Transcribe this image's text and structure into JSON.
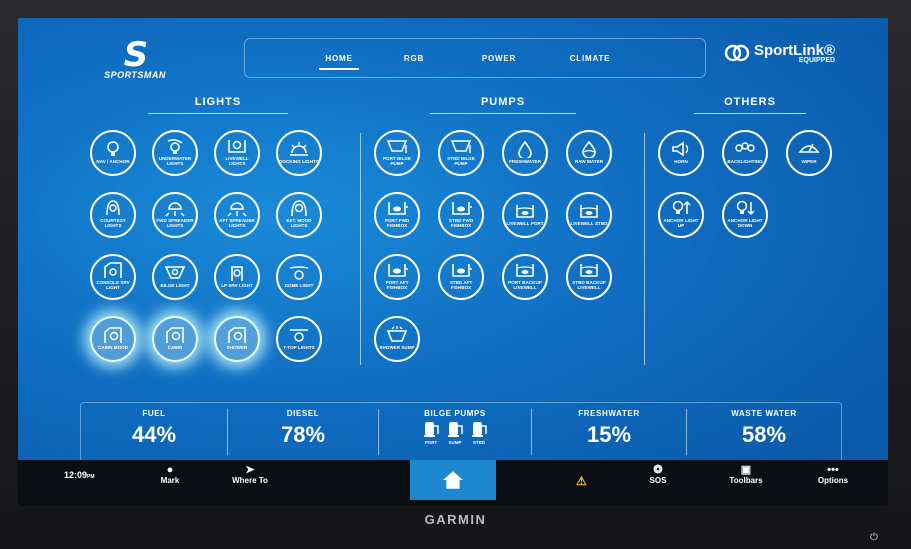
{
  "header": {
    "brand": {
      "mark": "S",
      "text": "SPORTSMAN"
    },
    "tabs": [
      {
        "label": "HOME",
        "active": true
      },
      {
        "label": "RGB",
        "active": false
      },
      {
        "label": "POWER",
        "active": false
      },
      {
        "label": "CLIMATE",
        "active": false
      }
    ],
    "sportlink": {
      "name": "SportLink®",
      "sub": "EQUIPPED"
    }
  },
  "sections": {
    "lights": "LIGHTS",
    "pumps": "PUMPS",
    "others": "OTHERS"
  },
  "lights": [
    {
      "label": "NAV / ANCHOR",
      "icon": "bulb-icon",
      "on": false
    },
    {
      "label": "UNDERWATER LIGHTS",
      "icon": "underwater-light-icon",
      "on": false
    },
    {
      "label": "LIVEWELL LIGHTS",
      "icon": "livewell-light-icon",
      "on": false
    },
    {
      "label": "DOCKING LIGHTS",
      "icon": "docking-light-icon",
      "on": false
    },
    {
      "label": "COURTESY LIGHTS",
      "icon": "courtesy-light-icon",
      "on": false
    },
    {
      "label": "FWD SPREADER LIGHTS",
      "icon": "spreader-light-icon",
      "on": false
    },
    {
      "label": "AFT SPREADER LIGHTS",
      "icon": "spreader-light-icon",
      "on": false
    },
    {
      "label": "EXT. MOOD LIGHTS",
      "icon": "mood-light-icon",
      "on": false
    },
    {
      "label": "CONSOLE SRV LIGHT",
      "icon": "console-light-icon",
      "on": false
    },
    {
      "label": "BILGE LIGHT",
      "icon": "bilge-light-icon",
      "on": false
    },
    {
      "label": "LP SRV LIGHT",
      "icon": "lp-light-icon",
      "on": false
    },
    {
      "label": "DOME LIGHT",
      "icon": "dome-light-icon",
      "on": false
    },
    {
      "label": "CABIN MOOD",
      "icon": "cabin-light-icon",
      "on": true
    },
    {
      "label": "CABIN",
      "icon": "cabin-light-icon",
      "on": true
    },
    {
      "label": "SHOWER",
      "icon": "shower-light-icon",
      "on": true
    },
    {
      "label": "T-TOP LIGHTS",
      "icon": "ttop-light-icon",
      "on": false
    }
  ],
  "pumps": [
    {
      "label": "PORT BILGE PUMP",
      "icon": "bilge-pump-icon"
    },
    {
      "label": "STBD BILGE PUMP",
      "icon": "bilge-pump-icon"
    },
    {
      "label": "FRESHWATER",
      "icon": "water-drop-icon"
    },
    {
      "label": "RAW WATER",
      "icon": "raw-water-icon"
    },
    {
      "label": "PORT FWD FISHBOX",
      "icon": "fishbox-icon"
    },
    {
      "label": "STBD FWD FISHBOX",
      "icon": "fishbox-icon"
    },
    {
      "label": "LIVEWELL PORT",
      "icon": "livewell-icon"
    },
    {
      "label": "LIVEWELL STBD",
      "icon": "livewell-icon"
    },
    {
      "label": "PORT AFT FISHBOX",
      "icon": "fishbox-icon"
    },
    {
      "label": "STBD AFT FISHBOX",
      "icon": "fishbox-icon"
    },
    {
      "label": "PORT BACKUP LIVEWELL",
      "icon": "livewell-icon"
    },
    {
      "label": "STBD BACKUP LIVEWELL",
      "icon": "livewell-icon"
    },
    {
      "label": "SHOWER SUMP",
      "icon": "sump-icon"
    }
  ],
  "others": [
    {
      "label": "HORN",
      "icon": "horn-icon"
    },
    {
      "label": "BACKLIGHTING",
      "icon": "backlighting-icon"
    },
    {
      "label": "WIPER",
      "icon": "wiper-icon"
    },
    {
      "label": "ANCHOR LIGHT UP",
      "icon": "anchor-light-up-icon"
    },
    {
      "label": "ANCHOR LIGHT DOWN",
      "icon": "anchor-light-down-icon"
    }
  ],
  "status": {
    "fuel": {
      "label": "FUEL",
      "value": "44%"
    },
    "diesel": {
      "label": "DIESEL",
      "value": "78%"
    },
    "bilge": {
      "label": "BILGE PUMPS",
      "pumps": [
        "PORT",
        "SUMP",
        "STBD"
      ]
    },
    "freshwater": {
      "label": "FRESHWATER",
      "value": "15%"
    },
    "waste": {
      "label": "WASTE WATER",
      "value": "58%"
    }
  },
  "bottom": {
    "time": "12:09",
    "time_suffix": "PM",
    "mark": "Mark",
    "whereto": "Where To",
    "sos": "SOS",
    "toolbars": "Toolbars",
    "options": "Options"
  },
  "device": {
    "brand": "GARMIN"
  }
}
